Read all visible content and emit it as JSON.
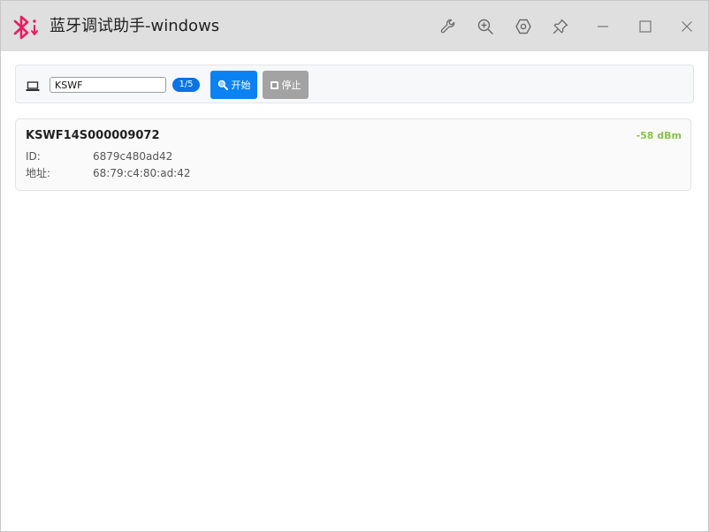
{
  "window": {
    "title": "蓝牙调试助手-windows"
  },
  "titlebar": {
    "buttons": [
      {
        "icon": "wrench-icon"
      },
      {
        "icon": "zoom-in-icon"
      },
      {
        "icon": "hexagon-settings-icon"
      },
      {
        "icon": "pin-icon"
      },
      {
        "icon": "minimize-icon"
      },
      {
        "icon": "maximize-icon"
      },
      {
        "icon": "close-icon"
      }
    ]
  },
  "toolbar": {
    "filter_value": "KSWF",
    "count": "1/5",
    "start_label": "开始",
    "stop_label": "停止"
  },
  "devices": [
    {
      "name": "KSWF14S000009072",
      "rssi": "-58 dBm",
      "id_label": "ID:",
      "id": "6879c480ad42",
      "address_label": "地址:",
      "address": "68:79:c4:80:ad:42"
    }
  ],
  "colors": {
    "accent": "#0a82f4",
    "badge": "#0a73e8",
    "rssi": "#8bc34a",
    "logo": "#e91e63",
    "stop_disabled": "#a3a3a3"
  }
}
